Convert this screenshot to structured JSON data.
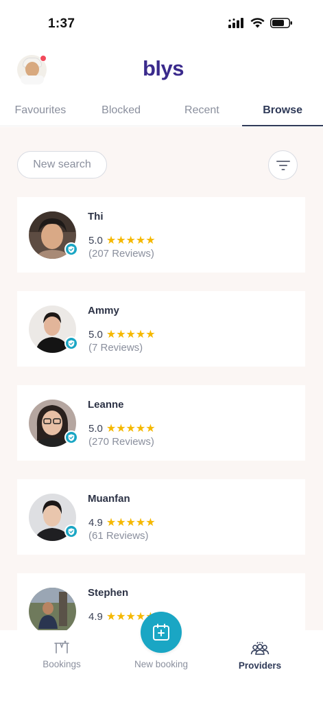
{
  "status_bar": {
    "time": "1:37"
  },
  "header": {
    "logo": "blys"
  },
  "tabs": [
    {
      "label": "Favourites",
      "active": false
    },
    {
      "label": "Blocked",
      "active": false
    },
    {
      "label": "Recent",
      "active": false
    },
    {
      "label": "Browse",
      "active": true
    }
  ],
  "browse": {
    "new_search_label": "New search",
    "providers": [
      {
        "name": "Thi",
        "rating": "5.0",
        "stars": 5,
        "reviews": "(207 Reviews)",
        "verified": true
      },
      {
        "name": "Ammy",
        "rating": "5.0",
        "stars": 5,
        "reviews": "(7 Reviews)",
        "verified": true
      },
      {
        "name": "Leanne",
        "rating": "5.0",
        "stars": 5,
        "reviews": "(270 Reviews)",
        "verified": true
      },
      {
        "name": "Muanfan",
        "rating": "4.9",
        "stars": 5,
        "reviews": "(61 Reviews)",
        "verified": true
      },
      {
        "name": "Stephen",
        "rating": "4.9",
        "stars": 5,
        "reviews": "",
        "verified": false
      }
    ]
  },
  "bottom_nav": {
    "bookings_label": "Bookings",
    "new_booking_label": "New booking",
    "providers_label": "Providers"
  },
  "colors": {
    "brand": "#3a2a8c",
    "accent": "#1aa6c4",
    "star": "#f5b800",
    "notification": "#f24a5b"
  }
}
